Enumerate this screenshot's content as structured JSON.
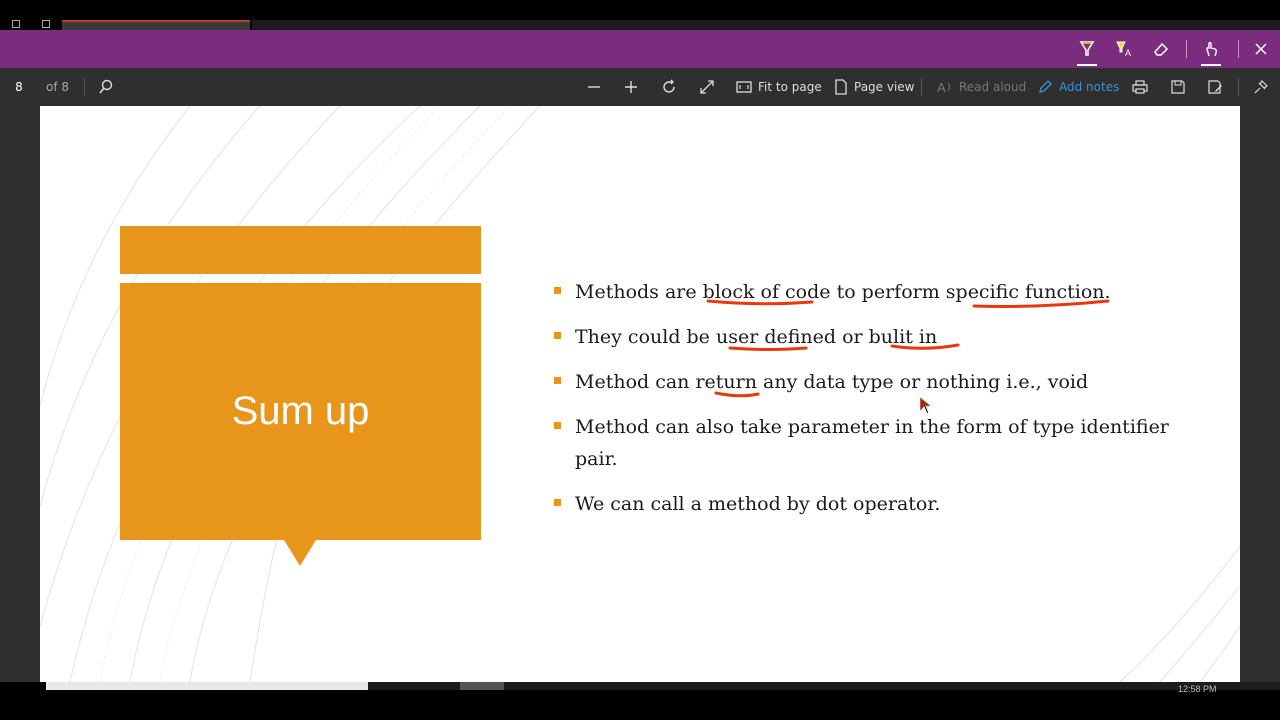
{
  "window": {
    "active_tab_accent": "#c0392b"
  },
  "ribbon": {
    "background": "#7b2d7d",
    "tools": [
      {
        "name": "draw-highlighter-icon"
      },
      {
        "name": "highlight-text-icon"
      },
      {
        "name": "eraser-icon"
      },
      {
        "name": "touch-writing-icon"
      },
      {
        "name": "close-icon"
      }
    ]
  },
  "toolbar": {
    "page_number": "8",
    "page_of": "of 8",
    "fit_to_page": "Fit to page",
    "page_view": "Page view",
    "read_aloud": "Read aloud",
    "add_notes": "Add notes"
  },
  "slide": {
    "title": "Sum up",
    "accent_color": "#e8961b",
    "bullets": [
      "Methods are block of code to perform specific function.",
      "They could be user defined or bulit in",
      "Method can return any data type or nothing i.e.,  void",
      "Method can also take parameter in the form of type identifier pair.",
      "We can call a method by dot operator."
    ],
    "ink_color": "#e8390e"
  },
  "taskbar": {
    "clock": "12:58 PM"
  }
}
